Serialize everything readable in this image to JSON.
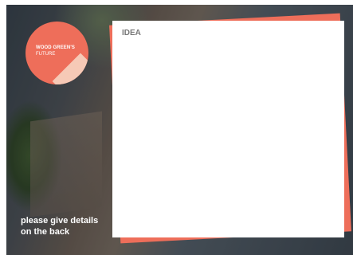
{
  "badge": {
    "line1": "WOOD GREEN'S",
    "line2": "FUTURE"
  },
  "card": {
    "title": "IDEA"
  },
  "note": {
    "line1": "please give details",
    "line2": "on the back"
  },
  "colors": {
    "accent": "#ee6e5a",
    "curl": "#f6c9b6",
    "card": "#ffffff",
    "title_text": "#777777"
  }
}
